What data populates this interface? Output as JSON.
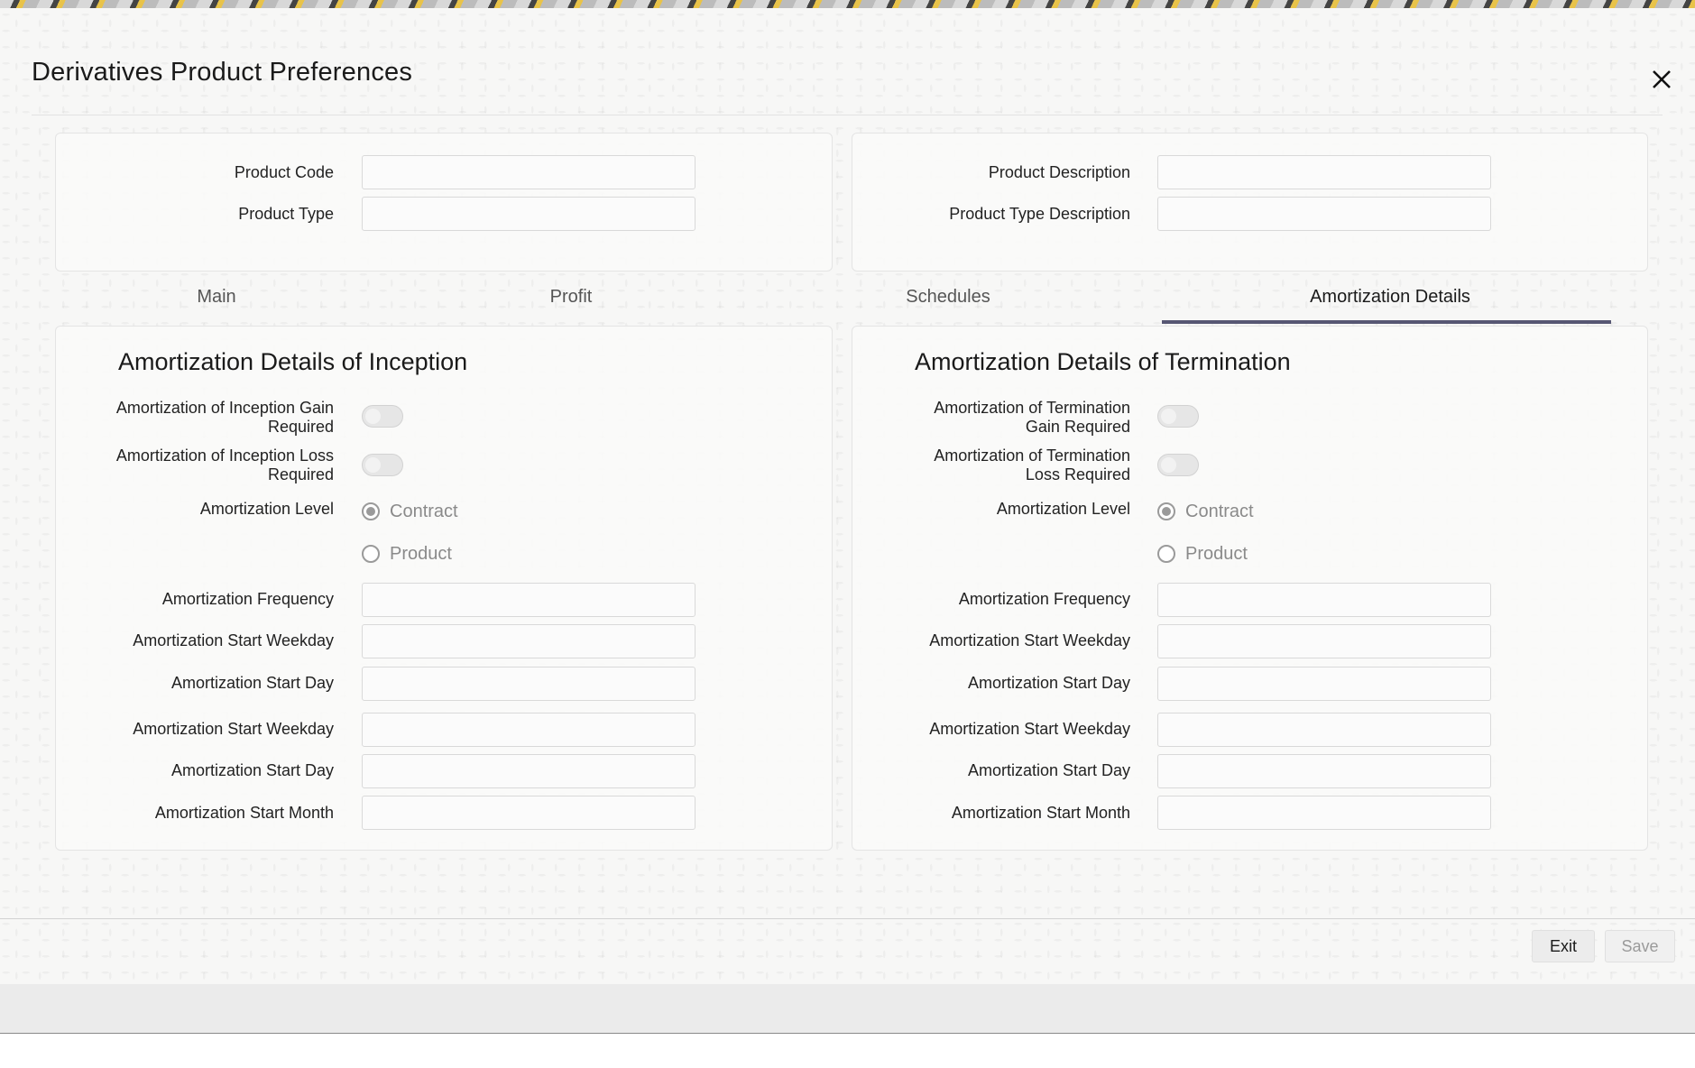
{
  "dialog": {
    "title": "Derivatives Product Preferences",
    "close_icon": "close-icon"
  },
  "header_fields": {
    "product_code_label": "Product Code",
    "product_code_value": "",
    "product_type_label": "Product Type",
    "product_type_value": "",
    "product_description_label": "Product Description",
    "product_description_value": "",
    "product_type_description_label": "Product Type Description",
    "product_type_description_value": ""
  },
  "tabs": [
    {
      "label": "Main",
      "active": false
    },
    {
      "label": "Profit",
      "active": false
    },
    {
      "label": "Schedules",
      "active": false
    },
    {
      "label": "Amortization Details",
      "active": true
    }
  ],
  "inception": {
    "section_title": "Amortization Details of Inception",
    "gain_required_label_1": "Amortization of Inception Gain",
    "gain_required_label_2": "Required",
    "gain_required": false,
    "loss_required_label_1": "Amortization of Inception Loss",
    "loss_required_label_2": "Required",
    "loss_required": false,
    "level_label": "Amortization Level",
    "level_options": [
      "Contract",
      "Product"
    ],
    "level_selected": "Contract",
    "frequency_label": "Amortization Frequency",
    "start_weekday_label": "Amortization Start Weekday",
    "start_day_label": "Amortization Start Day",
    "start_weekday_2_label": "Amortization Start Weekday",
    "start_day_2_label": "Amortization Start Day",
    "start_month_label": "Amortization Start Month"
  },
  "termination": {
    "section_title": "Amortization Details of Termination",
    "gain_required_label_1": "Amortization of Termination",
    "gain_required_label_2": "Gain Required",
    "gain_required": false,
    "loss_required_label_1": "Amortization of Termination",
    "loss_required_label_2": "Loss Required",
    "loss_required": false,
    "level_label": "Amortization Level",
    "level_options": [
      "Contract",
      "Product"
    ],
    "level_selected": "Contract",
    "frequency_label": "Amortization Frequency",
    "start_weekday_label": "Amortization Start Weekday",
    "start_day_label": "Amortization Start Day",
    "start_weekday_2_label": "Amortization Start Weekday",
    "start_day_2_label": "Amortization Start Day",
    "start_month_label": "Amortization Start Month"
  },
  "footer": {
    "exit_label": "Exit",
    "save_label": "Save"
  },
  "colors": {
    "tab_underline": "#575773",
    "panel_border": "#e4e4e4"
  }
}
